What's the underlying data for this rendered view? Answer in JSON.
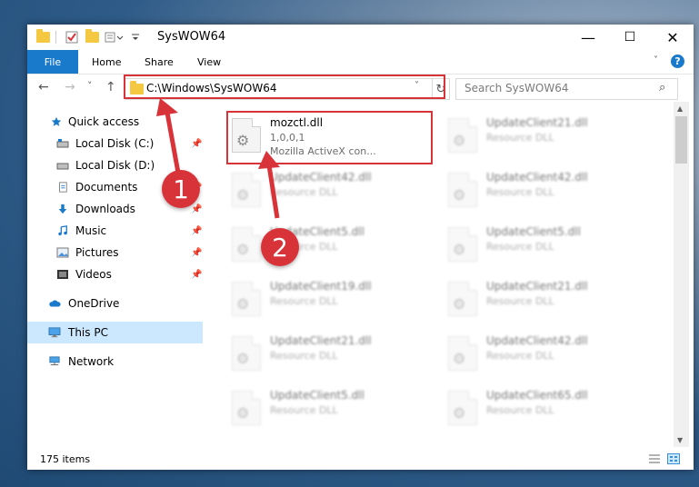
{
  "window": {
    "title": "SysWOW64",
    "controls": {
      "minimize": "—",
      "maximize": "☐",
      "close": "✕"
    }
  },
  "ribbon": {
    "tabs": [
      "File",
      "Home",
      "Share",
      "View"
    ],
    "help": "?"
  },
  "navbar": {
    "back": "←",
    "forward": "→",
    "recent": "˅",
    "up": "↑",
    "address": "C:\\Windows\\SysWOW64",
    "dropdown": "˅",
    "refresh": "↻",
    "search_placeholder": "Search SysWOW64",
    "search_icon": "⌕"
  },
  "sidebar": {
    "items": [
      {
        "label": "Quick access",
        "icon": "star-icon",
        "pinned": false
      },
      {
        "label": "Local Disk (C:)",
        "icon": "drive-icon",
        "pinned": true
      },
      {
        "label": "Local Disk (D:)",
        "icon": "drive-icon",
        "pinned": false
      },
      {
        "label": "Documents",
        "icon": "documents-icon",
        "pinned": true
      },
      {
        "label": "Downloads",
        "icon": "download-icon",
        "pinned": true
      },
      {
        "label": "Music",
        "icon": "music-icon",
        "pinned": true
      },
      {
        "label": "Pictures",
        "icon": "pictures-icon",
        "pinned": true
      },
      {
        "label": "Videos",
        "icon": "videos-icon",
        "pinned": true
      },
      {
        "label": "OneDrive",
        "icon": "cloud-icon",
        "pinned": false
      },
      {
        "label": "This PC",
        "icon": "computer-icon",
        "pinned": false,
        "selected": true
      },
      {
        "label": "Network",
        "icon": "network-icon",
        "pinned": false
      }
    ]
  },
  "files": [
    {
      "name": "mozctl.dll",
      "line2": "1,0,0,1",
      "line3": "Mozilla ActiveX con...",
      "highlighted": true
    },
    {
      "name": "UpdateClient21.dll",
      "line2": "Resource DLL"
    },
    {
      "name": "UpdateClient42.dll",
      "line2": "Resource DLL"
    },
    {
      "name": "UpdateClient42.dll",
      "line2": "Resource DLL"
    },
    {
      "name": "UpdateClient5.dll",
      "line2": "Resource DLL"
    },
    {
      "name": "UpdateClient5.dll",
      "line2": "Resource DLL"
    },
    {
      "name": "UpdateClient19.dll",
      "line2": "Resource DLL"
    },
    {
      "name": "UpdateClient21.dll",
      "line2": "Resource DLL"
    },
    {
      "name": "UpdateClient21.dll",
      "line2": "Resource DLL"
    },
    {
      "name": "UpdateClient42.dll",
      "line2": "Resource DLL"
    },
    {
      "name": "UpdateClient5.dll",
      "line2": "Resource DLL"
    },
    {
      "name": "UpdateClient65.dll",
      "line2": "Resource DLL"
    }
  ],
  "scrollbar": {
    "up": "▲",
    "down": "▼"
  },
  "status": {
    "items": "175 items"
  },
  "callouts": [
    "1",
    "2"
  ],
  "colors": {
    "accent": "#1979ca",
    "highlight": "#d9333a",
    "selected": "#cce8ff"
  }
}
